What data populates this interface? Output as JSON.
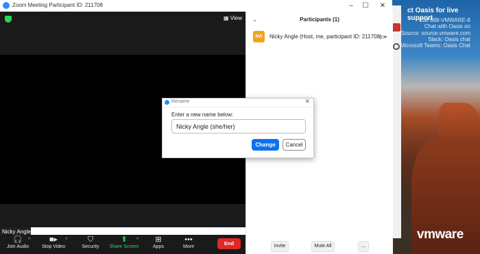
{
  "window": {
    "title": "Zoom Meeting Participant ID: 211708",
    "minimize": "–",
    "maximize": "☐",
    "close": "✕"
  },
  "video": {
    "view_label": "View",
    "name_tag": "Nicky Angle"
  },
  "toolbar": {
    "items": [
      {
        "label": "Join Audio",
        "icon": "headphones-icon"
      },
      {
        "label": "Stop Video",
        "icon": "video-camera-icon"
      },
      {
        "label": "Security",
        "icon": "shield-icon"
      },
      {
        "label": "Share Screen",
        "icon": "share-screen-icon"
      },
      {
        "label": "Apps",
        "icon": "apps-icon"
      },
      {
        "label": "More",
        "icon": "more-icon"
      }
    ],
    "end_label": "End"
  },
  "participants": {
    "title": "Participants (1)",
    "list": [
      {
        "initials": "NA",
        "name": "Nicky Angle (Host, me, participant ID: 211708)"
      }
    ],
    "invite_label": "Invite",
    "mute_all_label": "Mute All",
    "more_label": "..."
  },
  "rename_dialog": {
    "title": "Rename",
    "prompt": "Enter a new name below:",
    "value": "Nicky Angle (she/her)",
    "change_label": "Change",
    "cancel_label": "Cancel"
  },
  "desktop": {
    "oasis_header": "ct Oasis for live support",
    "oasis_lines": [
      "Call 888-VMWARE-8",
      "Chat with Oasis on",
      "Source: source.vmware.com",
      "Slack: Oasis chat",
      "Microsoft Teams: Oasis Chat"
    ],
    "logo": "vmware",
    "colors": {
      "zoom_blue": "#0e72ed",
      "end_red": "#e02828",
      "share_green": "#23d959",
      "avatar_orange": "#f6a11d"
    }
  }
}
